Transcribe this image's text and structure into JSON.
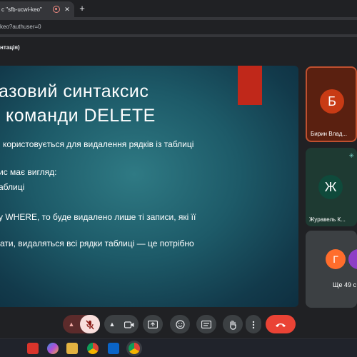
{
  "browser": {
    "tab_title": "c \"sfb-ucwi-keo\"",
    "tab_close": "✕",
    "new_tab": "+",
    "address": "keo?authuser=0"
  },
  "meeting": {
    "presentation_label": "нтація)"
  },
  "slide": {
    "heading_line1": "азовий синтаксис",
    "heading_line2": "команди DELETE",
    "lines": [
      "користовується для видалення рядків із таблиці",
      "ис має вигляд:",
      "аблиці",
      "у WHERE, то буде видалено лише ті записи, які її",
      "ати, видаляться всі рядки таблиці — це потрібно"
    ]
  },
  "participants": [
    {
      "initial": "Б",
      "name": "Бирин Влад...",
      "color": "#c83b15"
    },
    {
      "initial": "Ж",
      "name": "Журавель К...",
      "color": "#0f4a3b"
    },
    {
      "initial": "Г",
      "color": "#ff6d2c"
    }
  ],
  "more_participants": "Ще 49 с",
  "colors": {
    "hangup": "#ea4335",
    "slide_accent": "#c0281a",
    "mic_muted": "#f9dedc"
  },
  "controls": {
    "icons": [
      "chevron-up-icon",
      "mic-off-icon",
      "chevron-up-icon",
      "camera-icon",
      "present-icon",
      "emoji-icon",
      "captions-icon",
      "raise-hand-icon",
      "more-vert-icon",
      "hangup-icon"
    ]
  },
  "taskbar": {
    "icons": [
      "wps-icon",
      "copilot-icon",
      "file-explorer-icon",
      "chrome-icon",
      "outlook-icon",
      "chrome-active-icon"
    ]
  }
}
